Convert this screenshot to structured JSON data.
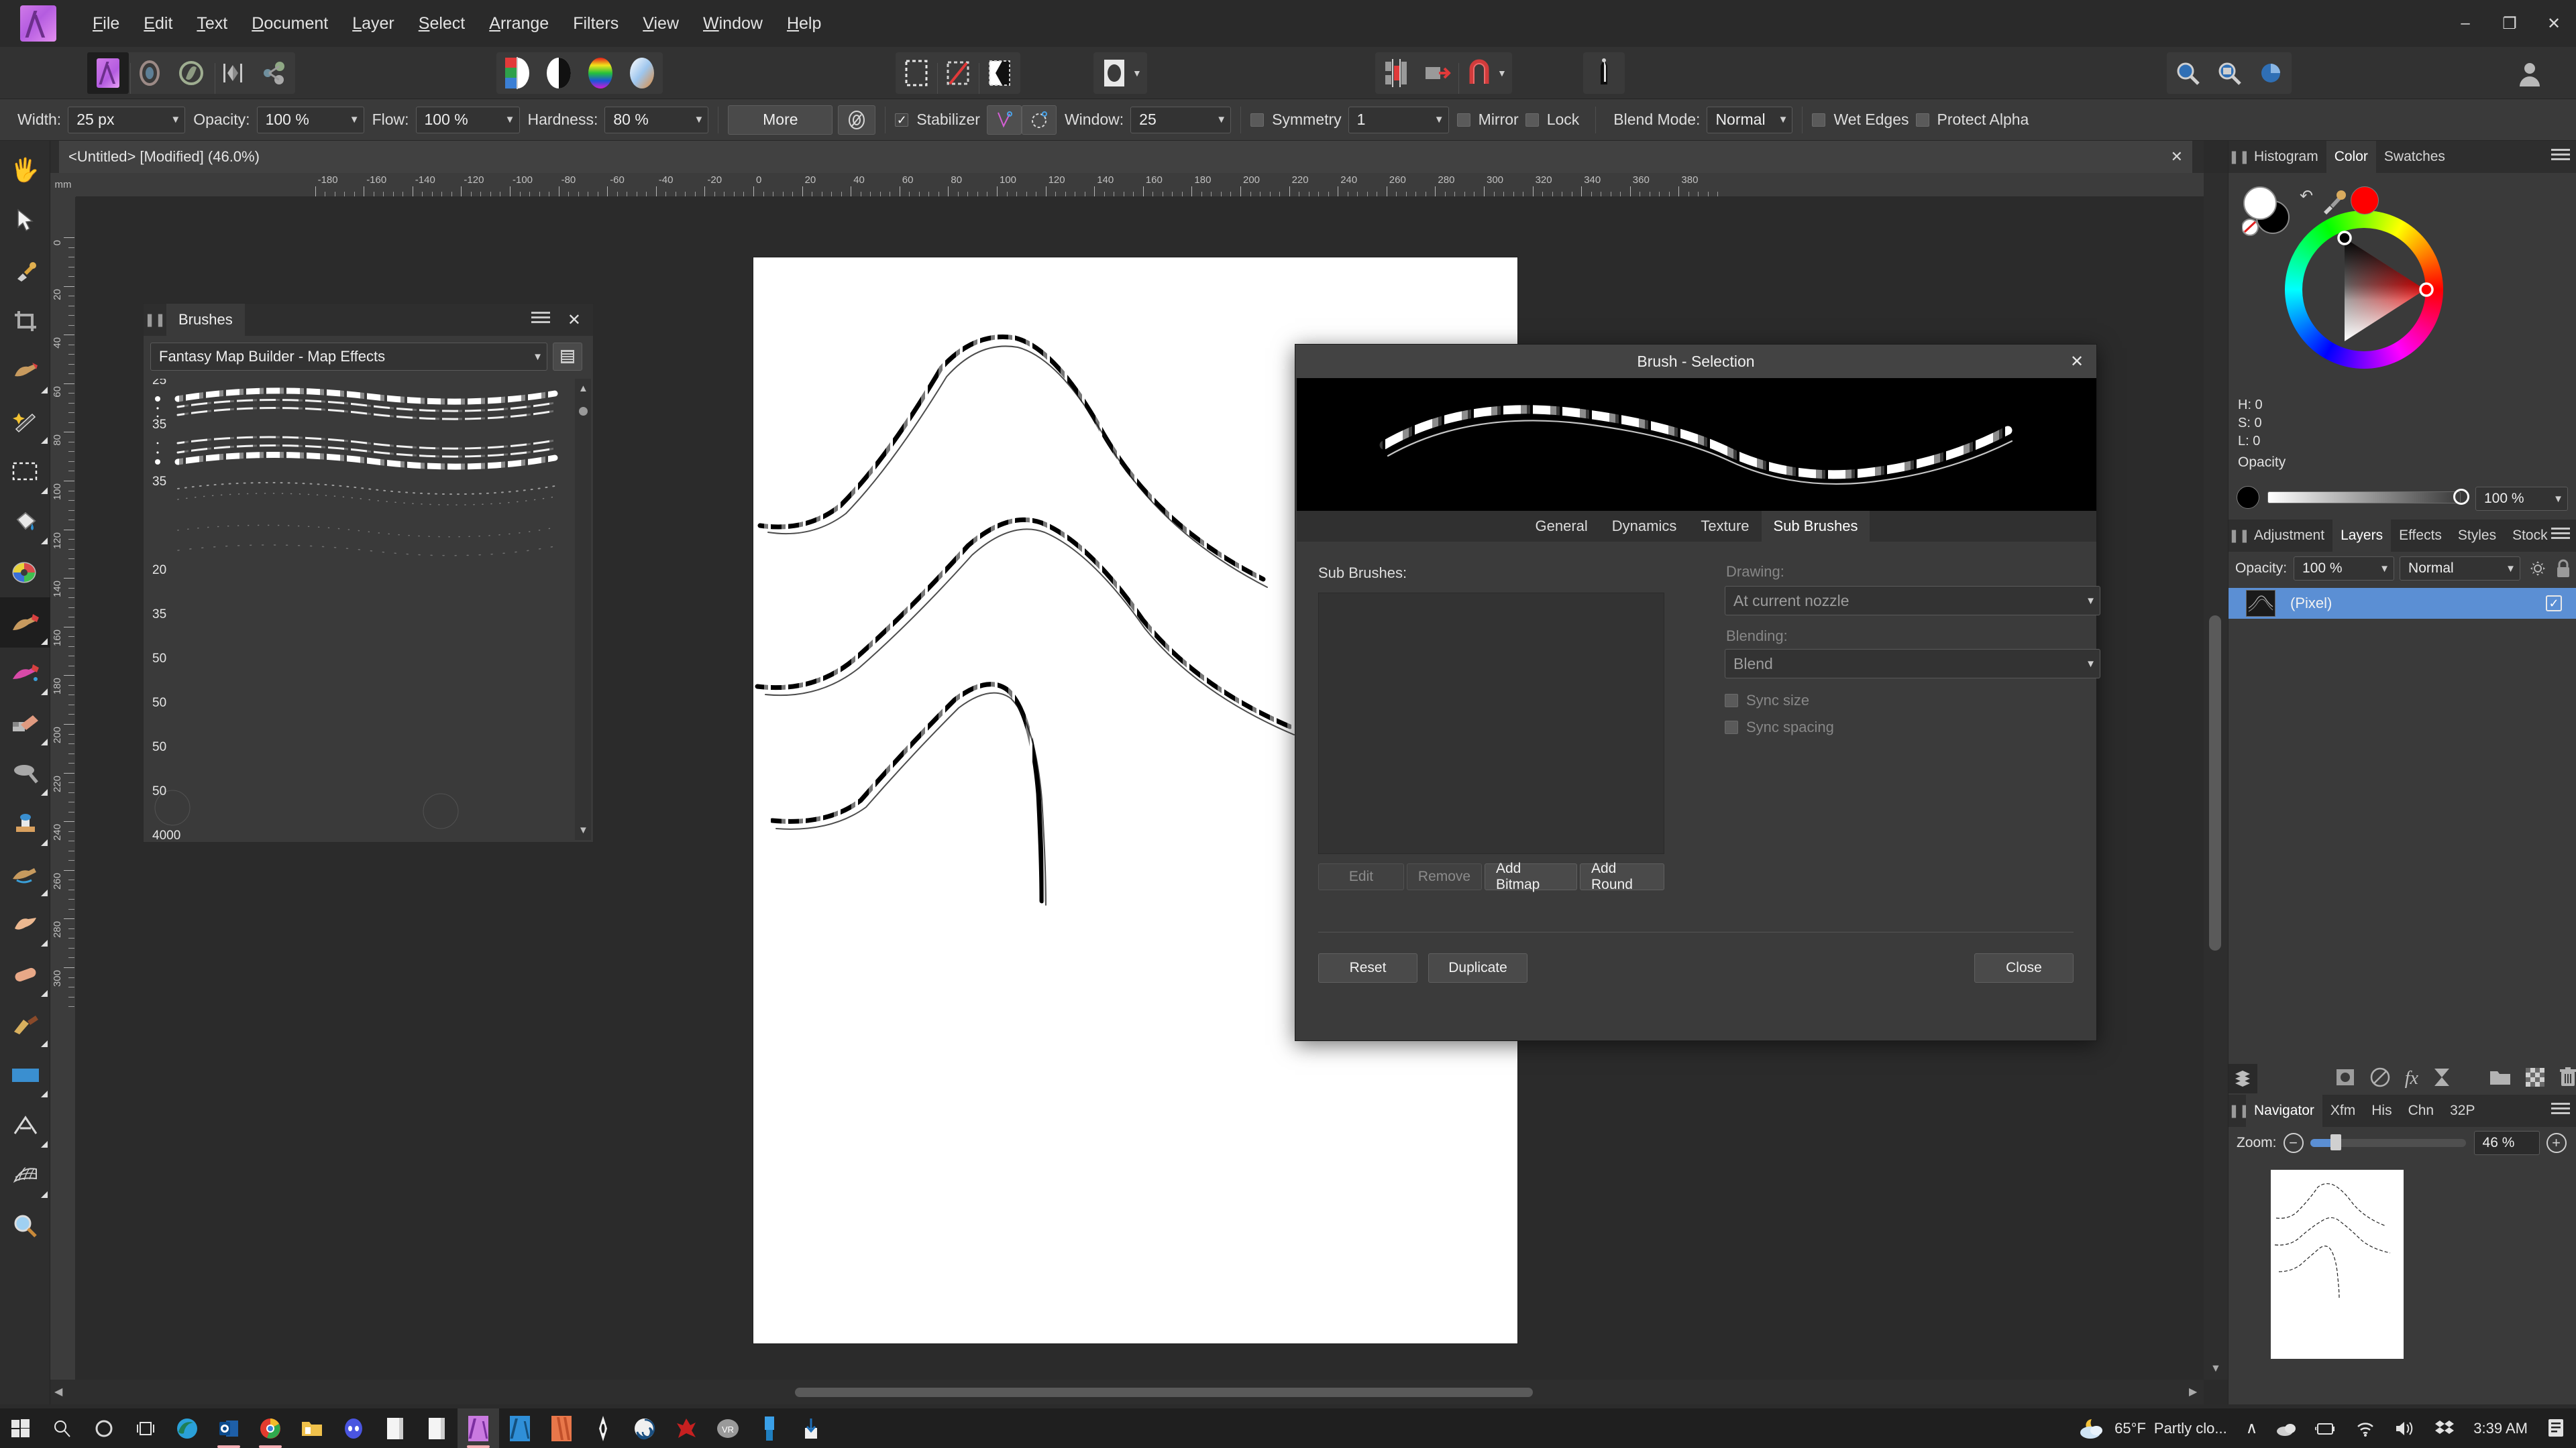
{
  "app": {
    "name": "Affinity Photo",
    "logo_icon": "affinity-logo"
  },
  "titlebar": {
    "menus": [
      "File",
      "Edit",
      "Text",
      "Document",
      "Layer",
      "Select",
      "Arrange",
      "Filters",
      "View",
      "Window",
      "Help"
    ],
    "window_buttons": {
      "minimize": "–",
      "maximize": "❐",
      "close": "✕"
    }
  },
  "toolbar": {
    "personas": [
      "photo-persona",
      "liquify-persona",
      "develop-persona",
      "tone-mapping-persona",
      "export-persona"
    ],
    "color_buttons": [
      "color-picker-swatch",
      "grayscale-swatch",
      "color-wheel-swatch",
      "gradient-swatch"
    ],
    "selection_buttons": [
      "marquee-icon",
      "lasso-icon",
      "refine-selection-icon"
    ],
    "shape_button": "ellipse-icon",
    "align_buttons": [
      "align-icon",
      "distribute-icon",
      "snapping-icon"
    ],
    "assistant_button": "assistant-icon",
    "account_button": "account-icon"
  },
  "context": {
    "width_label": "Width:",
    "width_value": "25 px",
    "opacity_label": "Opacity:",
    "opacity_value": "100 %",
    "flow_label": "Flow:",
    "flow_value": "100 %",
    "hardness_label": "Hardness:",
    "hardness_value": "80 %",
    "more_label": "More",
    "brush_settings_icon": "brush-settings-icon",
    "stabilizer_label": "Stabilizer",
    "stabilizer_checked": true,
    "stabilizer_modes": [
      "rope-mode-icon",
      "window-mode-icon"
    ],
    "window_label": "Window:",
    "window_value": "25",
    "symmetry_label": "Symmetry",
    "symmetry_checked": false,
    "symmetry_value": "1",
    "mirror_label": "Mirror",
    "mirror_checked": false,
    "lock_label": "Lock",
    "lock_checked": false,
    "blend_mode_label": "Blend Mode:",
    "blend_mode_value": "Normal",
    "wet_edges_label": "Wet Edges",
    "wet_edges_checked": false,
    "protect_alpha_label": "Protect Alpha",
    "protect_alpha_checked": false
  },
  "tools": [
    {
      "name": "view-tool",
      "icon": "hand-icon",
      "selected": false,
      "flyout": false
    },
    {
      "name": "move-tool",
      "icon": "cursor-icon",
      "selected": false,
      "flyout": false
    },
    {
      "name": "colour-picker-tool",
      "icon": "eyedropper-icon",
      "selected": false,
      "flyout": false
    },
    {
      "name": "crop-tool",
      "icon": "crop-icon",
      "selected": false,
      "flyout": false
    },
    {
      "name": "selection-brush-tool",
      "icon": "selection-brush-icon",
      "selected": false,
      "flyout": true
    },
    {
      "name": "flood-select-tool",
      "icon": "magic-wand-icon",
      "selected": false,
      "flyout": true
    },
    {
      "name": "marquee-tool",
      "icon": "marquee-icon",
      "selected": false,
      "flyout": true
    },
    {
      "name": "flood-fill-tool",
      "icon": "paint-bucket-icon",
      "selected": false,
      "flyout": true
    },
    {
      "name": "paint-mixer-tool",
      "icon": "paint-mixer-icon",
      "selected": false,
      "flyout": false
    },
    {
      "name": "paint-brush-tool",
      "icon": "paint-brush-icon",
      "selected": true,
      "flyout": true
    },
    {
      "name": "pixel-tool",
      "icon": "pixel-brush-icon",
      "selected": false,
      "flyout": true
    },
    {
      "name": "erase-brush-tool",
      "icon": "eraser-icon",
      "selected": false,
      "flyout": true
    },
    {
      "name": "dodge-brush-tool",
      "icon": "dodge-icon",
      "selected": false,
      "flyout": true
    },
    {
      "name": "clone-brush-tool",
      "icon": "clone-stamp-icon",
      "selected": false,
      "flyout": true
    },
    {
      "name": "undo-brush-tool",
      "icon": "undo-brush-icon",
      "selected": false,
      "flyout": true
    },
    {
      "name": "smudge-brush-tool",
      "icon": "smudge-icon",
      "selected": false,
      "flyout": true
    },
    {
      "name": "healing-brush-tool",
      "icon": "healing-brush-icon",
      "selected": false,
      "flyout": true
    },
    {
      "name": "pen-tool",
      "icon": "pen-icon",
      "selected": false,
      "flyout": true
    },
    {
      "name": "rectangle-tool",
      "icon": "rectangle-icon",
      "selected": false,
      "flyout": true
    },
    {
      "name": "artistic-text-tool",
      "icon": "text-icon",
      "selected": false,
      "flyout": true
    },
    {
      "name": "mesh-warp-tool",
      "icon": "mesh-warp-icon",
      "selected": false,
      "flyout": true
    },
    {
      "name": "zoom-tool",
      "icon": "magnifier-icon",
      "selected": false,
      "flyout": false
    }
  ],
  "document": {
    "tab_title": "<Untitled> [Modified] (46.0%)",
    "tab_close": "✕",
    "ruler_unit": "mm",
    "ruler_h_ticks": [
      "-180",
      "-160",
      "-140",
      "-120",
      "-100",
      "-80",
      "-60",
      "-40",
      "-20",
      "0",
      "20",
      "40",
      "60",
      "80",
      "100",
      "120",
      "140",
      "160",
      "180",
      "200",
      "220",
      "240",
      "260",
      "280",
      "300",
      "320",
      "340",
      "360",
      "380"
    ],
    "ruler_v_ticks": [
      "0",
      "20",
      "40",
      "60",
      "80",
      "100",
      "120",
      "140",
      "160",
      "180",
      "200",
      "220",
      "240",
      "260",
      "280",
      "300"
    ]
  },
  "brushes_panel": {
    "title": "Brushes",
    "grip_icon": "panel-grip-icon",
    "menu_icon": "panel-menu-icon",
    "close_icon": "close-icon",
    "category_value": "Fantasy Map Builder - Map Effects",
    "view_mode_icon": "list-view-icon",
    "brush_sizes": [
      "25",
      "35",
      "35",
      "20",
      "35",
      "50",
      "50",
      "50",
      "50",
      "4000"
    ],
    "scroll_up_icon": "scroll-up-icon",
    "scroll_down_icon": "scroll-down-icon"
  },
  "brush_dialog": {
    "title": "Brush - Selection",
    "close_icon": "close-icon",
    "preview_name": "brush-stroke-preview",
    "tabs": [
      {
        "label": "General",
        "selected": false
      },
      {
        "label": "Dynamics",
        "selected": false
      },
      {
        "label": "Texture",
        "selected": false
      },
      {
        "label": "Sub Brushes",
        "selected": true
      }
    ],
    "sub_brushes_label": "Sub Brushes:",
    "list_items": [],
    "list_buttons": [
      {
        "label": "Edit",
        "disabled": true
      },
      {
        "label": "Remove",
        "disabled": true
      },
      {
        "label": "Add Bitmap",
        "disabled": false
      },
      {
        "label": "Add Round",
        "disabled": false
      }
    ],
    "drawing_label": "Drawing:",
    "drawing_value": "At current nozzle",
    "blending_label": "Blending:",
    "blending_value": "Blend",
    "sync_size_label": "Sync size",
    "sync_size_checked": false,
    "sync_spacing_label": "Sync spacing",
    "sync_spacing_checked": false,
    "footer_buttons": [
      {
        "label": "Reset"
      },
      {
        "label": "Duplicate"
      },
      {
        "label": "Close"
      }
    ]
  },
  "right_panel": {
    "top_tabs": [
      {
        "label": "Histogram",
        "selected": false
      },
      {
        "label": "Color",
        "selected": true
      },
      {
        "label": "Swatches",
        "selected": false
      }
    ],
    "color": {
      "foreground_hex": "#ffffff",
      "background_hex": "#000000",
      "none_swatch_icon": "no-color-icon",
      "swap_icon": "swap-colors-icon",
      "picker_icon": "eyedropper-icon",
      "recent_hex": "#ff0000",
      "h_label": "H: 0",
      "s_label": "S: 0",
      "l_label": "L: 0",
      "opacity_label": "Opacity",
      "opacity_value": "100 %"
    },
    "layer_tabs": [
      {
        "label": "Adjustment",
        "selected": false
      },
      {
        "label": "Layers",
        "selected": true
      },
      {
        "label": "Effects",
        "selected": false
      },
      {
        "label": "Styles",
        "selected": false
      },
      {
        "label": "Stock",
        "selected": false
      }
    ],
    "layers": {
      "opacity_label": "Opacity:",
      "opacity_value": "100 %",
      "blend_value": "Normal",
      "gear_icon": "gear-icon",
      "lock_icon": "lock-icon",
      "rows": [
        {
          "name": "(Pixel)",
          "visible": true,
          "selected": true
        }
      ],
      "bottom_icons": [
        "layer-stack-icon",
        "mask-icon",
        "adjustment-icon",
        "fx-icon",
        "live-filter-icon",
        "group-icon",
        "new-pixel-layer-icon",
        "delete-icon"
      ]
    },
    "nav_tabs": [
      {
        "label": "Navigator",
        "selected": true
      },
      {
        "label": "Xfm",
        "selected": false
      },
      {
        "label": "His",
        "selected": false
      },
      {
        "label": "Chn",
        "selected": false
      },
      {
        "label": "32P",
        "selected": false
      }
    ],
    "navigator": {
      "zoom_label": "Zoom:",
      "zoom_out_icon": "zoom-out-icon",
      "zoom_in_icon": "zoom-in-icon",
      "zoom_value": "46 %"
    }
  },
  "taskbar": {
    "items": [
      {
        "name": "start-button",
        "icon": "windows-icon"
      },
      {
        "name": "search-button",
        "icon": "search-icon"
      },
      {
        "name": "cortana-button",
        "icon": "circle-icon"
      },
      {
        "name": "task-view-button",
        "icon": "task-view-icon"
      },
      {
        "name": "edge-button",
        "icon": "edge-icon",
        "running": false
      },
      {
        "name": "outlook-button",
        "icon": "outlook-icon",
        "running": true
      },
      {
        "name": "chrome-button",
        "icon": "chrome-icon",
        "running": true
      },
      {
        "name": "file-explorer-button",
        "icon": "folder-icon",
        "running": false
      },
      {
        "name": "discord-button",
        "icon": "discord-icon",
        "running": false
      },
      {
        "name": "notepad-button",
        "icon": "document-icon",
        "running": false
      },
      {
        "name": "word-button",
        "icon": "document-icon",
        "running": false
      },
      {
        "name": "affinity-photo-button",
        "icon": "affinity-photo-icon",
        "running": true,
        "active": true
      },
      {
        "name": "affinity-designer-button",
        "icon": "affinity-designer-icon",
        "running": false
      },
      {
        "name": "affinity-publisher-button",
        "icon": "affinity-publisher-icon",
        "running": false
      },
      {
        "name": "blender-button",
        "icon": "blender-icon",
        "running": false
      },
      {
        "name": "spiral-app-button",
        "icon": "spiral-icon",
        "running": false
      },
      {
        "name": "red-app-button",
        "icon": "red-splash-icon",
        "running": false
      },
      {
        "name": "vr-app-button",
        "icon": "vr-icon",
        "running": false
      },
      {
        "name": "blue-app-button",
        "icon": "blue-app-icon",
        "running": false
      },
      {
        "name": "download-button",
        "icon": "download-icon",
        "running": false
      }
    ],
    "tray": {
      "weather_icon": "partly-cloudy-icon",
      "weather_temp": "65°F",
      "weather_text": "Partly clo...",
      "chevron_icon": "chevron-up-icon",
      "onedrive_icon": "cloud-icon",
      "battery_icon": "battery-icon",
      "wifi_icon": "wifi-icon",
      "volume_icon": "volume-icon",
      "dropbox_icon": "dropbox-icon",
      "clock": "3:39 AM",
      "notifications_icon": "notifications-icon"
    }
  },
  "colors": {
    "accent": "#5b8fd4",
    "panel_bg": "#3a3a3a",
    "dark_bg": "#2e2e2e",
    "canvas_bg": "#2b2b2b"
  }
}
